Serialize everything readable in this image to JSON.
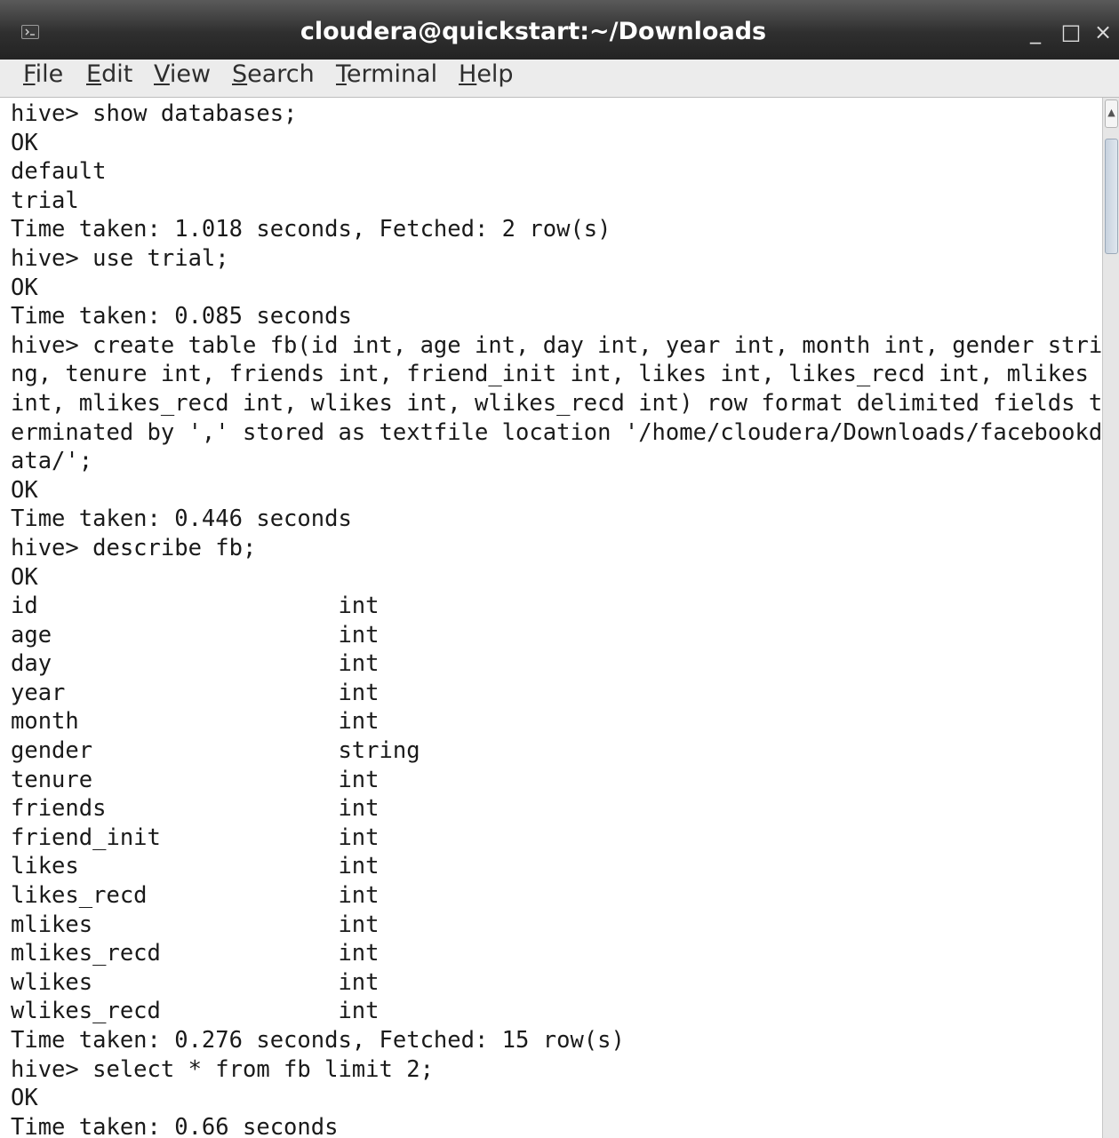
{
  "window": {
    "title": "cloudera@quickstart:~/Downloads",
    "minimize_glyph": "_",
    "maximize_glyph": "□",
    "close_glyph": "×",
    "icon": "terminal-icon"
  },
  "menu": [
    {
      "label": "File"
    },
    {
      "label": "Edit"
    },
    {
      "label": "View"
    },
    {
      "label": "Search"
    },
    {
      "label": "Terminal"
    },
    {
      "label": "Help"
    }
  ],
  "terminal": {
    "lines": [
      "hive> show databases;",
      "OK",
      "default",
      "trial",
      "Time taken: 1.018 seconds, Fetched: 2 row(s)",
      "hive> use trial;",
      "OK",
      "Time taken: 0.085 seconds",
      "hive> create table fb(id int, age int, day int, year int, month int, gender stri",
      "ng, tenure int, friends int, friend_init int, likes int, likes_recd int, mlikes ",
      "int, mlikes_recd int, wlikes int, wlikes_recd int) row format delimited fields t",
      "erminated by ',' stored as textfile location '/home/cloudera/Downloads/facebookd",
      "ata/';",
      "OK",
      "Time taken: 0.446 seconds",
      "hive> describe fb;",
      "OK",
      "id                      int",
      "age                     int",
      "day                     int",
      "year                    int",
      "month                   int",
      "gender                  string",
      "tenure                  int",
      "friends                 int",
      "friend_init             int",
      "likes                   int",
      "likes_recd              int",
      "mlikes                  int",
      "mlikes_recd             int",
      "wlikes                  int",
      "wlikes_recd             int",
      "Time taken: 0.276 seconds, Fetched: 15 row(s)",
      "hive> select * from fb limit 2;",
      "OK",
      "Time taken: 0.66 seconds"
    ]
  },
  "colors": {
    "titlebar": "#2f2f2f",
    "title_text": "#ffffff",
    "menubar": "#ececec",
    "terminal_bg": "#ffffff",
    "terminal_fg": "#1a1a1a"
  }
}
